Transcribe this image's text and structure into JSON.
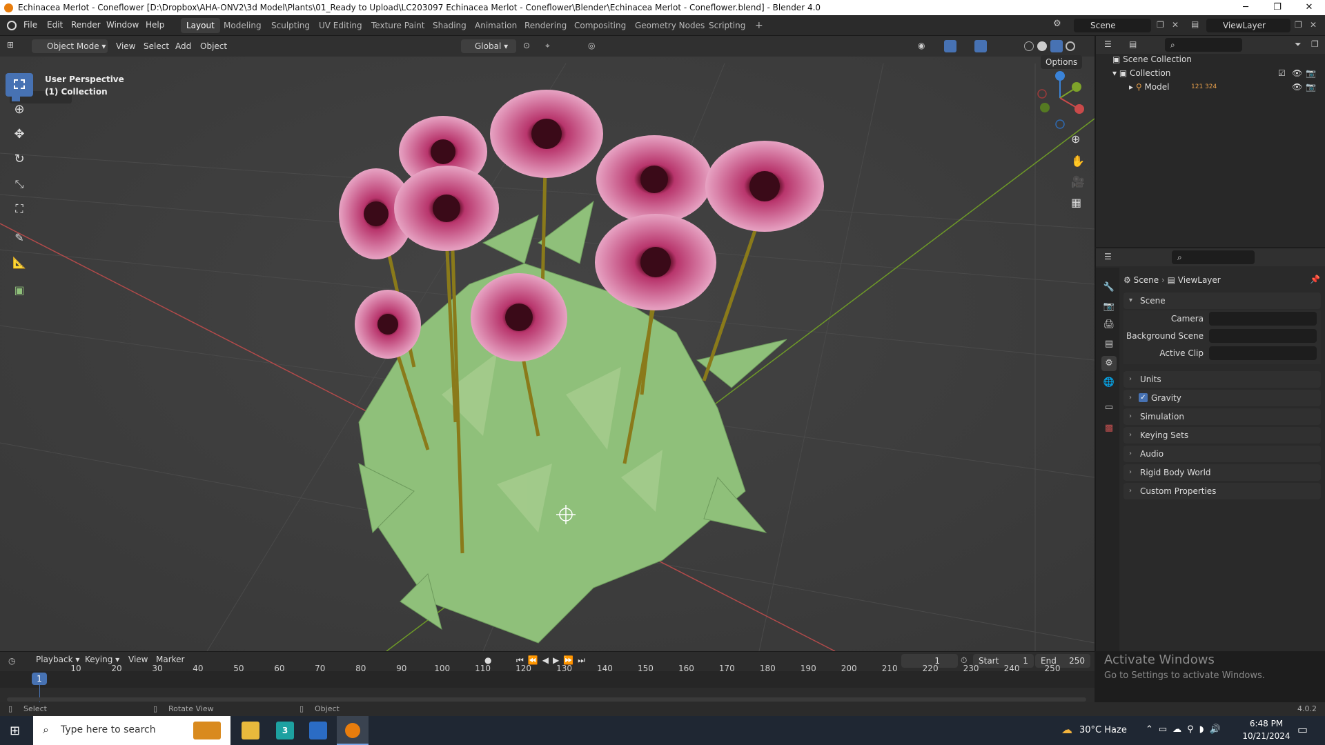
{
  "window": {
    "title": "Echinacea Merlot - Coneflower [D:\\Dropbox\\AHA-ONV2\\3d Model\\Plants\\01_Ready to Upload\\LC203097 Echinacea Merlot - Coneflower\\Blender\\Echinacea Merlot - Coneflower.blend] - Blender 4.0",
    "minimize": "─",
    "restore": "❐",
    "close": "✕"
  },
  "menu": [
    "File",
    "Edit",
    "Render",
    "Window",
    "Help"
  ],
  "workspaces": [
    "Layout",
    "Modeling",
    "Sculpting",
    "UV Editing",
    "Texture Paint",
    "Shading",
    "Animation",
    "Rendering",
    "Compositing",
    "Geometry Nodes",
    "Scripting",
    "+"
  ],
  "active_workspace": "Layout",
  "scene_field": "Scene",
  "viewlayer_field": "ViewLayer",
  "viewport_header": {
    "mode": "Object Mode",
    "menus": [
      "View",
      "Select",
      "Add",
      "Object"
    ],
    "transform_orientation": "Global",
    "options": "Options"
  },
  "viewport": {
    "perspective": "User Perspective",
    "collection": "(1) Collection"
  },
  "outliner": {
    "scene_collection": "Scene Collection",
    "collection": "Collection",
    "model": "Model",
    "model_badge": "121 324"
  },
  "properties": {
    "breadcrumb_scene": "Scene",
    "breadcrumb_viewlayer": "ViewLayer",
    "panel_scene": "Scene",
    "camera_label": "Camera",
    "background_scene_label": "Background Scene",
    "active_clip_label": "Active Clip",
    "subpanels": [
      "Units",
      "Gravity",
      "Simulation",
      "Keying Sets",
      "Audio",
      "Rigid Body World",
      "Custom Properties"
    ]
  },
  "timeline": {
    "menus": [
      "Playback",
      "Keying",
      "View",
      "Marker"
    ],
    "current_frame": "1",
    "start_label": "Start",
    "start_value": "1",
    "end_label": "End",
    "end_value": "250",
    "ticks": [
      "1",
      "10",
      "20",
      "30",
      "40",
      "50",
      "60",
      "70",
      "80",
      "90",
      "100",
      "110",
      "120",
      "130",
      "140",
      "150",
      "160",
      "170",
      "180",
      "190",
      "200",
      "210",
      "220",
      "230",
      "240",
      "250"
    ]
  },
  "statusbar": {
    "select": "Select",
    "rotate": "Rotate View",
    "object": "Object",
    "version": "4.0.2"
  },
  "activate_windows": {
    "title": "Activate Windows",
    "subtitle": "Go to Settings to activate Windows."
  },
  "taskbar": {
    "search_placeholder": "Type here to search",
    "weather": "30°C  Haze",
    "time": "6:48 PM",
    "date": "10/21/2024"
  },
  "colors": {
    "accent_blue": "#4772b3",
    "blender_orange": "#e87d0d",
    "x_axis": "#c94a4a",
    "y_axis": "#7ea32a",
    "z_axis": "#3a83d8",
    "petal": "#d96aa3",
    "leaf": "#8fc07a"
  }
}
